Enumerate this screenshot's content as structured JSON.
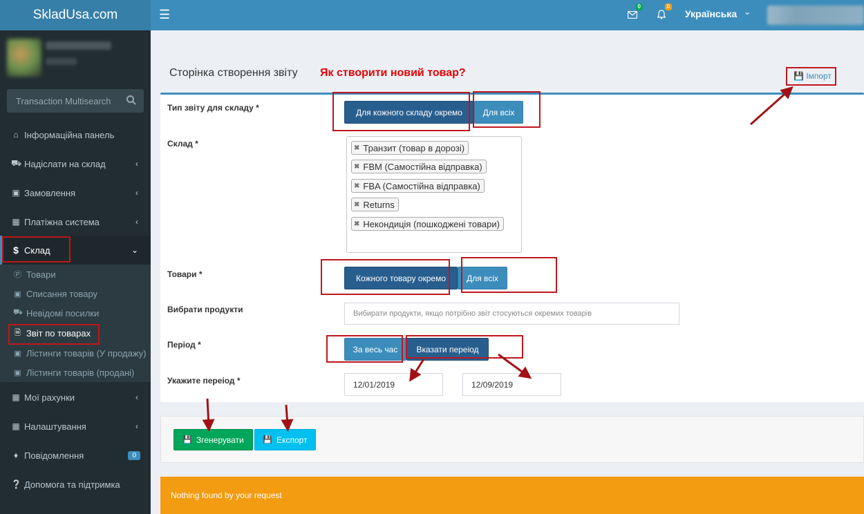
{
  "header": {
    "logo": "SkladUsa.com",
    "mail_count": "0",
    "bell_count": "0",
    "language": "Українська"
  },
  "sidebar": {
    "search_placeholder": "Transaction Multisearch",
    "items": [
      {
        "label": "Інформаційна панель",
        "icon": "home-icon"
      },
      {
        "label": "Надіслати на склад",
        "icon": "truck-icon"
      },
      {
        "label": "Замовлення",
        "icon": "basket-icon"
      },
      {
        "label": "Платіжна система",
        "icon": "grid-icon"
      },
      {
        "label": "Склад",
        "icon": "dollar-icon"
      }
    ],
    "sub_items": [
      {
        "label": "Товари"
      },
      {
        "label": "Списання товару"
      },
      {
        "label": "Невідомі посилки"
      },
      {
        "label": "Звіт по товарах"
      },
      {
        "label": "Лістинги товарів (У продажу)"
      },
      {
        "label": "Лістинги товарів (продані)"
      }
    ],
    "bottom_items": [
      {
        "label": "Мої рахунки"
      },
      {
        "label": "Налаштування"
      },
      {
        "label": "Повідомлення",
        "badge": "0"
      },
      {
        "label": "Допомога та підтримка"
      }
    ]
  },
  "content": {
    "page_title": "Сторінка створення звіту",
    "howto_link": "Як створити новий товар?",
    "import_link": "Імпорт",
    "form": {
      "report_type_label": "Тип звіту для складу *",
      "report_type_option_each": "Для кожного складу окремо",
      "report_type_option_all": "Для всіх",
      "warehouse_label": "Склад *",
      "warehouse_tags": [
        "Транзит (товар в дорозі)",
        "FBM (Самостійна відправка)",
        "FBA (Самостійна відправка)",
        "Returns",
        "Некондиція (пошкоджені товари)"
      ],
      "products_label": "Товари *",
      "products_option_each": "Кожного товару окремо",
      "products_option_all": "Для всіх",
      "choose_products_label": "Вибрати продукти",
      "choose_products_placeholder": "Вибирати продукти, якщо потрібно звіт стосуються окремих товарів",
      "period_label": "Період *",
      "period_option_all": "За весь час",
      "period_option_custom": "Вказати переіод",
      "date_range_label": "Укажите переіод *",
      "date_from": "12/01/2019",
      "date_to": "12/09/2019"
    },
    "generate_button": "Згенерувати",
    "export_button": "Експорт",
    "alert_text": "Nothing found by your request"
  },
  "colors": {
    "topbar": "#3c8dbc",
    "sidebar": "#222d32",
    "annotation": "#c0161c",
    "alert": "#f39c12"
  }
}
